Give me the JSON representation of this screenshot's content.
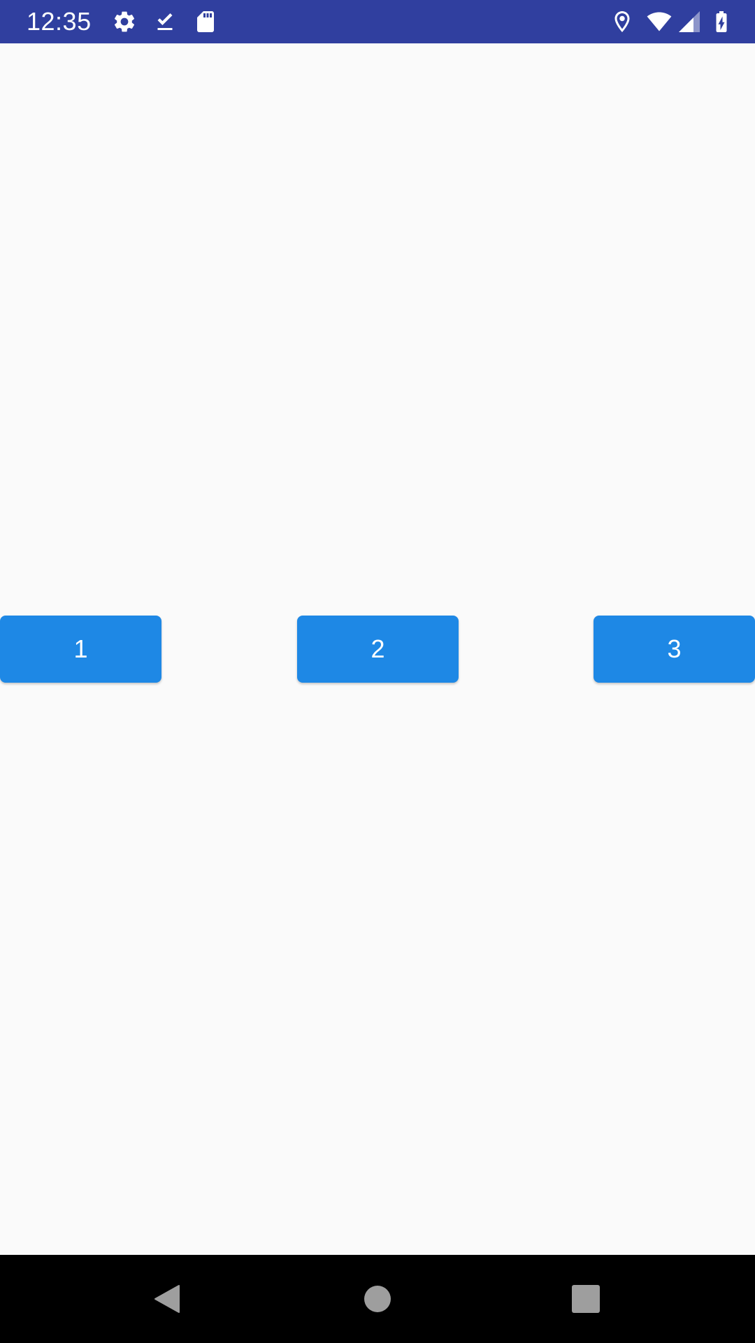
{
  "status_bar": {
    "time": "12:35",
    "background": "#303F9F",
    "left_icons": [
      "settings-gear-icon",
      "download-done-icon",
      "sd-card-icon"
    ],
    "right_icons": [
      "location-icon",
      "wifi-icon",
      "cell-signal-icon",
      "battery-charging-icon"
    ]
  },
  "main": {
    "buttons": [
      {
        "label": "1"
      },
      {
        "label": "2"
      },
      {
        "label": "3"
      }
    ],
    "button_color": "#1E88E5",
    "background": "#FAFAFA"
  },
  "nav_bar": {
    "icons": [
      "back-icon",
      "home-icon",
      "recents-icon"
    ],
    "background": "#000000"
  }
}
